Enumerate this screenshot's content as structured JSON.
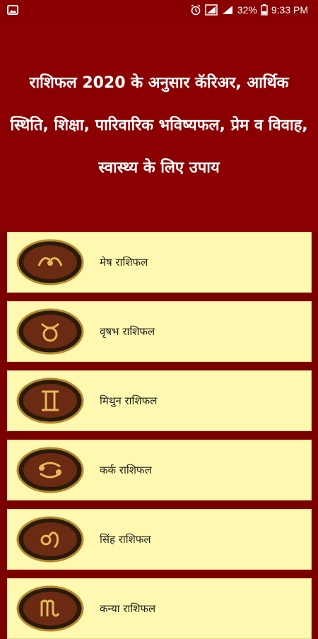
{
  "status_bar": {
    "battery": "32%",
    "time": "9:33 PM",
    "icons": [
      "image-icon",
      "alarm-icon",
      "data-icon",
      "signal-icon",
      "battery-icon"
    ]
  },
  "header": {
    "title": "राशिफल 2020 के अनुसार कॅरिअर, आर्थिक स्थिति, शिक्षा, पारिवारिक भविष्यफल, प्रेम व विवाह, स्वास्थ्य के लिए उपाय"
  },
  "list": {
    "items": [
      {
        "label": "मेष राशिफल",
        "icon": "aries-icon"
      },
      {
        "label": "वृषभ राशिफल",
        "icon": "taurus-icon"
      },
      {
        "label": "मिथुन राशिफल",
        "icon": "gemini-icon"
      },
      {
        "label": "कर्क राशिफल",
        "icon": "cancer-icon"
      },
      {
        "label": "सिंह राशिफल",
        "icon": "leo-icon"
      },
      {
        "label": "कन्या राशिफल",
        "icon": "virgo-icon"
      }
    ]
  },
  "colors": {
    "header_bg": "#8b0000",
    "page_bg": "#7a0000",
    "item_bg": "#fff8b0",
    "emblem_gold": "#d4a640"
  }
}
